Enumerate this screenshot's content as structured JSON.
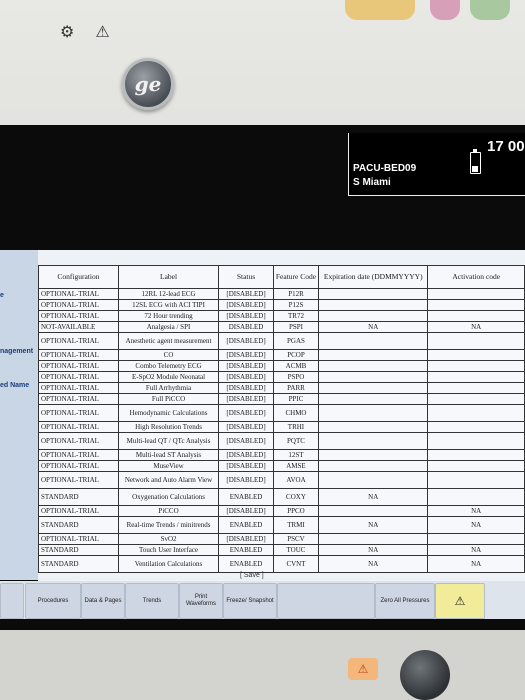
{
  "device": {
    "logo_text": "ge",
    "top_icons": "⚙ ⚠"
  },
  "patient": {
    "bed": "PACU-BED09",
    "name": "S Miami",
    "time": "17 00"
  },
  "left_menu": [
    {
      "label": "e"
    },
    {
      "label": "nagement"
    },
    {
      "label": "ed Name"
    }
  ],
  "table": {
    "headers": [
      "Configuration",
      "Label",
      "Status",
      "Feature Code",
      "Expiration date (DDMMYYYY)",
      "Activation code"
    ],
    "rows": [
      {
        "cfg": "OPTIONAL-TRIAL",
        "label": "12RL 12-lead ECG",
        "status": "[DISABLED]",
        "code": "P12R",
        "exp": "",
        "act": ""
      },
      {
        "cfg": "OPTIONAL-TRIAL",
        "label": "12SL ECG with ACI TIPI",
        "status": "[DISABLED]",
        "code": "P12S",
        "exp": "",
        "act": ""
      },
      {
        "cfg": "OPTIONAL-TRIAL",
        "label": "72 Hour trending",
        "status": "[DISABLED]",
        "code": "TR72",
        "exp": "",
        "act": ""
      },
      {
        "cfg": "NOT-AVAILABLE",
        "label": "Analgesia / SPI",
        "status": "DISABLED",
        "code": "PSPI",
        "exp": "NA",
        "act": "NA"
      },
      {
        "cfg": "OPTIONAL-TRIAL",
        "label": "Anesthetic agent measurement",
        "status": "[DISABLED]",
        "code": "PGAS",
        "exp": "",
        "act": ""
      },
      {
        "cfg": "OPTIONAL-TRIAL",
        "label": "CO",
        "status": "[DISABLED]",
        "code": "PCOP",
        "exp": "",
        "act": ""
      },
      {
        "cfg": "OPTIONAL-TRIAL",
        "label": "Combo Telemetry ECG",
        "status": "[DISABLED]",
        "code": "ACMB",
        "exp": "",
        "act": ""
      },
      {
        "cfg": "OPTIONAL-TRIAL",
        "label": "E-SpO2 Module Neonatal",
        "status": "[DISABLED]",
        "code": "PSPO",
        "exp": "",
        "act": ""
      },
      {
        "cfg": "OPTIONAL-TRIAL",
        "label": "Full Arrhythmia",
        "status": "[DISABLED]",
        "code": "PARR",
        "exp": "",
        "act": ""
      },
      {
        "cfg": "OPTIONAL-TRIAL",
        "label": "Full PiCCO",
        "status": "[DISABLED]",
        "code": "PPIC",
        "exp": "",
        "act": ""
      },
      {
        "cfg": "OPTIONAL-TRIAL",
        "label": "Hemodynamic Calculations",
        "status": "[DISABLED]",
        "code": "CHMO",
        "exp": "",
        "act": ""
      },
      {
        "cfg": "OPTIONAL-TRIAL",
        "label": "High Resolution Trends",
        "status": "[DISABLED]",
        "code": "TRHI",
        "exp": "",
        "act": ""
      },
      {
        "cfg": "OPTIONAL-TRIAL",
        "label": "Multi-lead QT / QTc Analysis",
        "status": "[DISABLED]",
        "code": "PQTC",
        "exp": "",
        "act": ""
      },
      {
        "cfg": "OPTIONAL-TRIAL",
        "label": "Multi-lead ST Analysis",
        "status": "[DISABLED]",
        "code": "12ST",
        "exp": "",
        "act": ""
      },
      {
        "cfg": "OPTIONAL-TRIAL",
        "label": "MuseView",
        "status": "[DISABLED]",
        "code": "AMSE",
        "exp": "",
        "act": ""
      },
      {
        "cfg": "OPTIONAL-TRIAL",
        "label": "Network and Auto Alarm View",
        "status": "[DISABLED]",
        "code": "AVOA",
        "exp": "",
        "act": ""
      },
      {
        "cfg": "STANDARD",
        "label": "Oxygenation Calculations",
        "status": "ENABLED",
        "code": "COXY",
        "exp": "NA",
        "act": ""
      },
      {
        "cfg": "OPTIONAL-TRIAL",
        "label": "PiCCO",
        "status": "[DISABLED]",
        "code": "PPCO",
        "exp": "",
        "act": "NA"
      },
      {
        "cfg": "STANDARD",
        "label": "Real-time Trends / minitrends",
        "status": "ENABLED",
        "code": "TRMI",
        "exp": "NA",
        "act": "NA"
      },
      {
        "cfg": "OPTIONAL-TRIAL",
        "label": "SvO2",
        "status": "[DISABLED]",
        "code": "PSCV",
        "exp": "",
        "act": ""
      },
      {
        "cfg": "STANDARD",
        "label": "Touch User Interface",
        "status": "ENABLED",
        "code": "TOUC",
        "exp": "NA",
        "act": "NA"
      },
      {
        "cfg": "STANDARD",
        "label": "Ventilation Calculations",
        "status": "ENABLED",
        "code": "CVNT",
        "exp": "NA",
        "act": "NA"
      }
    ]
  },
  "save_label": "[ Save ]",
  "bottom_tabs": [
    {
      "label": "Procedures"
    },
    {
      "label": "Data & Pages"
    },
    {
      "label": "Trends"
    },
    {
      "label": "Print Waveforms"
    },
    {
      "label": "Freeze/ Snapshot"
    },
    {
      "label": ""
    },
    {
      "label": "Zero All Pressures"
    },
    {
      "label": "⚠"
    }
  ],
  "hardware": {
    "alarm_icon": "⚠"
  },
  "colors": {
    "screen_bg": "#0b0b0b",
    "table_bg": "#f6f8fb",
    "menu_blue": "#c9d6e6",
    "alarm_button": "#f2eb9a"
  }
}
